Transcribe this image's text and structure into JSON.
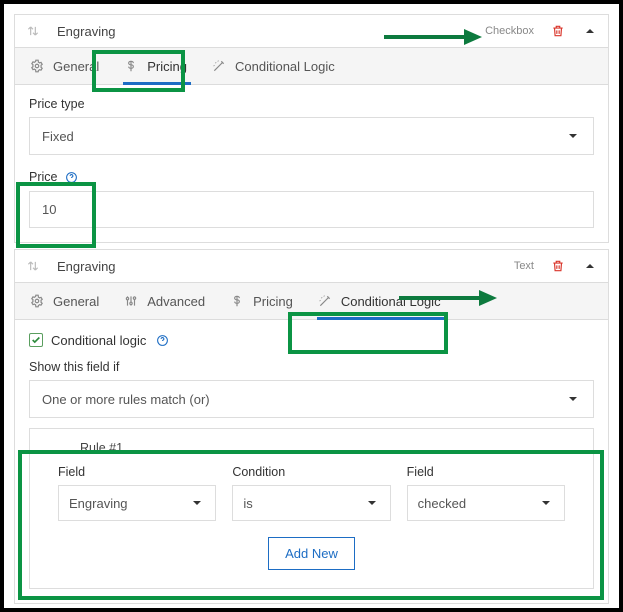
{
  "card1": {
    "title": "Engraving",
    "type": "Checkbox",
    "tabs": {
      "general": "General",
      "pricing": "Pricing",
      "conditional": "Conditional Logic"
    },
    "price_type_label": "Price type",
    "price_type_value": "Fixed",
    "price_label": "Price",
    "price_value": "10"
  },
  "card2": {
    "title": "Engraving",
    "type": "Text",
    "tabs": {
      "general": "General",
      "advanced": "Advanced",
      "pricing": "Pricing",
      "conditional": "Conditional Logic"
    },
    "enable_label": "Conditional logic",
    "show_label": "Show this field if",
    "show_value": "One or more rules match (or)",
    "rule": {
      "title": "Rule #1",
      "field_label": "Field",
      "condition_label": "Condition",
      "value_label": "Field",
      "field_value": "Engraving",
      "condition_value": "is",
      "value_value": "checked",
      "add": "Add New"
    }
  }
}
